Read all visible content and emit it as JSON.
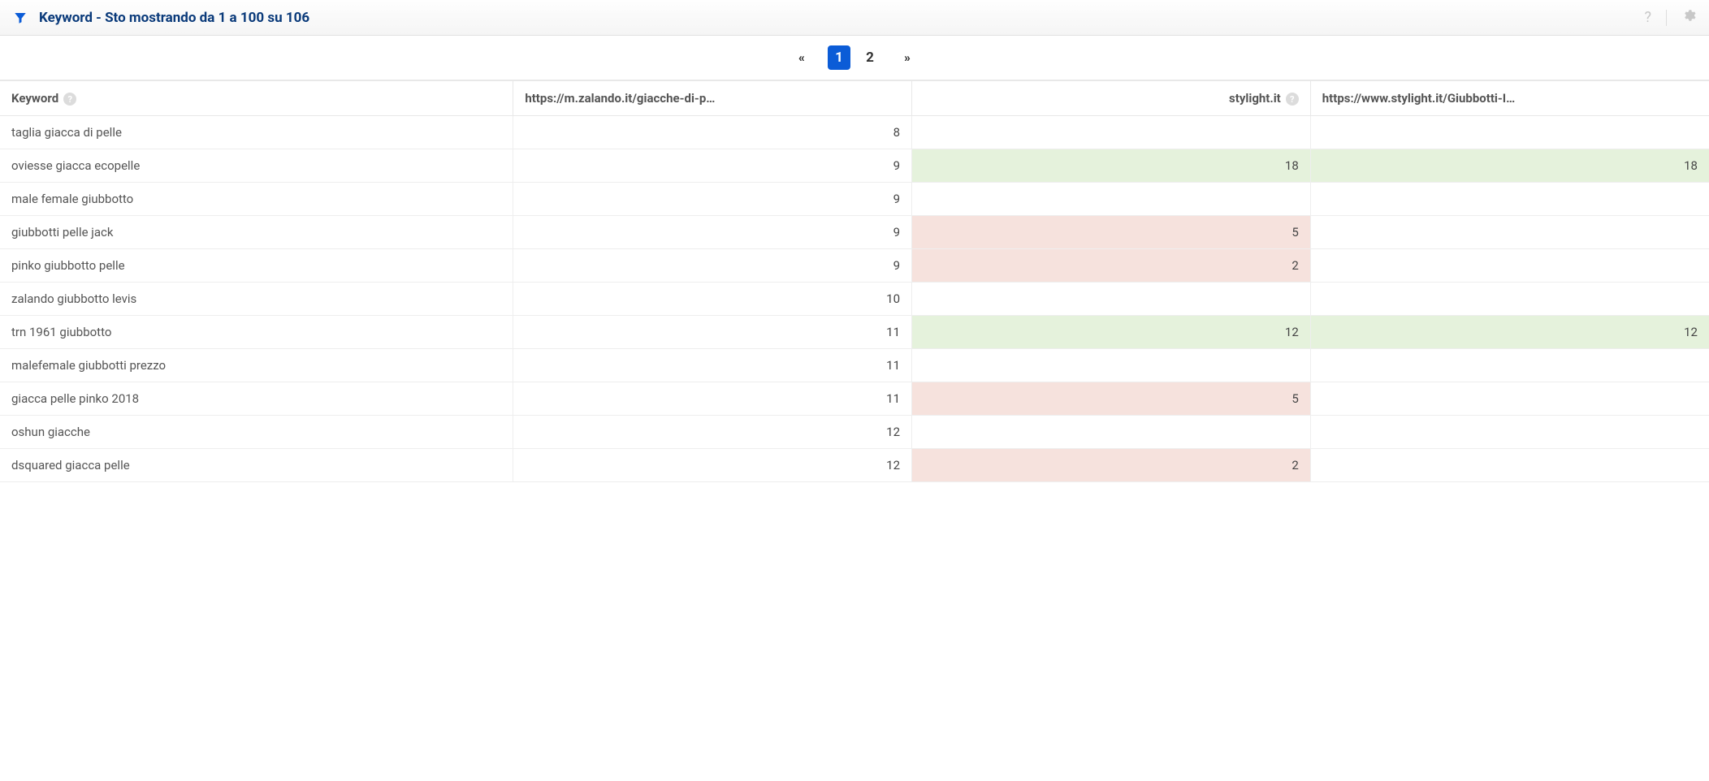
{
  "header": {
    "title": "Keyword - Sto mostrando da 1 a 100 su 106"
  },
  "pagination": {
    "first": "«",
    "pages": [
      "1",
      "2"
    ],
    "active_page": "1",
    "last": "»"
  },
  "columns": {
    "keyword": "Keyword",
    "col1": "https://m.zalando.it/giacche-di-p…",
    "col2": "stylight.it",
    "col3": "https://www.stylight.it/Giubbotti-I…"
  },
  "rows": [
    {
      "keyword": "taglia giacca di pelle",
      "v1": "8",
      "v2": "",
      "v3": "",
      "c2": "",
      "c3": ""
    },
    {
      "keyword": "oviesse giacca ecopelle",
      "v1": "9",
      "v2": "18",
      "v3": "18",
      "c2": "green",
      "c3": "green"
    },
    {
      "keyword": "male female giubbotto",
      "v1": "9",
      "v2": "",
      "v3": "",
      "c2": "",
      "c3": ""
    },
    {
      "keyword": "giubbotti pelle jack",
      "v1": "9",
      "v2": "5",
      "v3": "",
      "c2": "red",
      "c3": ""
    },
    {
      "keyword": "pinko giubbotto pelle",
      "v1": "9",
      "v2": "2",
      "v3": "",
      "c2": "red",
      "c3": ""
    },
    {
      "keyword": "zalando giubbotto levis",
      "v1": "10",
      "v2": "",
      "v3": "",
      "c2": "",
      "c3": ""
    },
    {
      "keyword": "trn 1961 giubbotto",
      "v1": "11",
      "v2": "12",
      "v3": "12",
      "c2": "green",
      "c3": "green"
    },
    {
      "keyword": "malefemale giubbotti prezzo",
      "v1": "11",
      "v2": "",
      "v3": "",
      "c2": "",
      "c3": ""
    },
    {
      "keyword": "giacca pelle pinko 2018",
      "v1": "11",
      "v2": "5",
      "v3": "",
      "c2": "red",
      "c3": ""
    },
    {
      "keyword": "oshun giacche",
      "v1": "12",
      "v2": "",
      "v3": "",
      "c2": "",
      "c3": ""
    },
    {
      "keyword": "dsquared giacca pelle",
      "v1": "12",
      "v2": "2",
      "v3": "",
      "c2": "red",
      "c3": ""
    }
  ]
}
